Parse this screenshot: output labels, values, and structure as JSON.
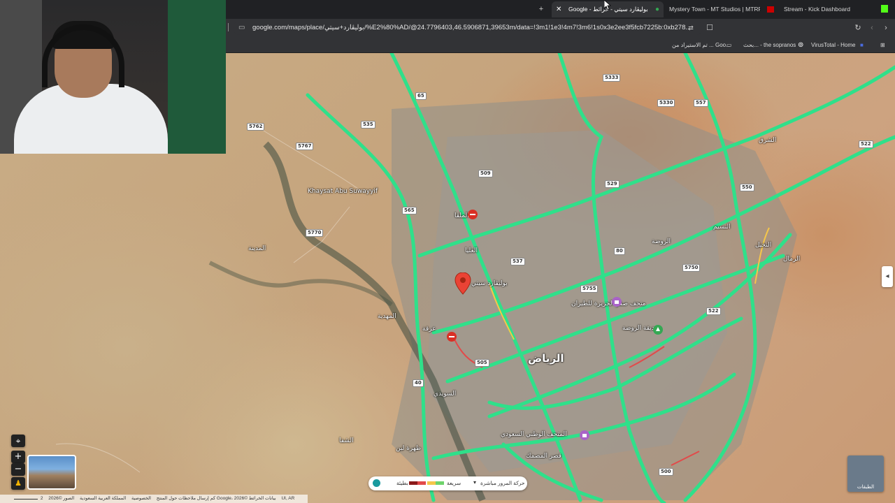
{
  "browser": {
    "tabs": [
      {
        "label": "Google - بوليڤارد سيتي - خرائط",
        "active": true
      },
      {
        "label": "Mystery Town - MT Studios | MTRP",
        "active": false
      },
      {
        "label": "Stream - Kick Dashboard",
        "active": false
      }
    ],
    "url": "google.com/maps/place/بوليڤارد+سيتي/%E2%80%AD/@24.7796403,46.5906871,39653m/data=!3m1!1e3!4m7!3m6!1s0x3e2ee3f5fcb7225b:0xb278...",
    "bookmarks": [
      {
        "label": "VirusTotal - Home"
      },
      {
        "label": "بحث... - the sopranos"
      },
      {
        "label": "تم الاستيراد من ... Goo..."
      }
    ]
  },
  "map": {
    "city_label": "الرياض",
    "pin_label": "بوليڤارد سيتي",
    "place_labels": [
      {
        "text": "Khaysat Abu Suwayyif"
      },
      {
        "text": "المتحف الوطني السعودي"
      },
      {
        "text": "متحف صقر الجزيرة للطيران"
      },
      {
        "text": "حديقة الروضة"
      },
      {
        "text": "قصر المصمك"
      },
      {
        "text": "المدينة"
      },
      {
        "text": "العليا"
      },
      {
        "text": "الملقا"
      },
      {
        "text": "النسيم"
      },
      {
        "text": "الشفا"
      },
      {
        "text": "المهدية"
      },
      {
        "text": "عرقة"
      },
      {
        "text": "ظهرة لبن"
      },
      {
        "text": "السويدي"
      },
      {
        "text": "الروضة"
      },
      {
        "text": "النخيل"
      },
      {
        "text": "الشرق"
      },
      {
        "text": "الرمال"
      }
    ],
    "road_shields": [
      "65",
      "535",
      "509",
      "5762",
      "5767",
      "5770",
      "529",
      "537",
      "557",
      "80",
      "5755",
      "5750",
      "522",
      "500",
      "5333",
      "5330",
      "550",
      "522",
      "40",
      "505",
      "565"
    ],
    "controls": {
      "layers_label": "الطبقات",
      "zoom_in": "+",
      "zoom_out": "−"
    },
    "traffic": {
      "title": "حركة المرور مباشرة",
      "fast": "سريعة",
      "slow": "بطيئة",
      "colors": [
        "#6ed36b",
        "#f5c64a",
        "#e24a4a",
        "#8b1a1a"
      ]
    },
    "footer": {
      "imagery": "الصور ©2026 Google، بيانات الخرائط ©2026",
      "terms": "المملكة العربية السعودية",
      "privacy": "الخصوصية",
      "feedback": "إرسال ملاحظات حول المنتج",
      "scale": "2 كم",
      "ui_label": "UI, AR"
    }
  }
}
